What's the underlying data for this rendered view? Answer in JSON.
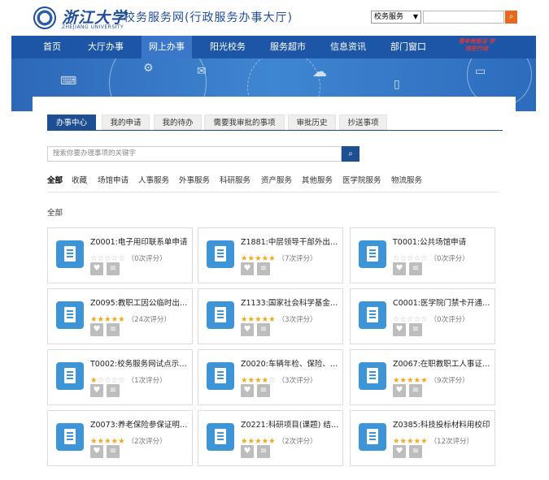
{
  "header": {
    "logo_cn": "浙江大学",
    "logo_en": "ZHEJIANG UNIVERSITY",
    "site_title": "校务服务网(行政服务办事大厅)",
    "scope_select": "校务服务",
    "search_button_icon": "search-icon"
  },
  "nav": {
    "items": [
      "首页",
      "大厅办事",
      "网上办事",
      "阳光校务",
      "服务超市",
      "信息资讯",
      "部门窗口"
    ],
    "active_index": 2,
    "slogan": "青年有担当 学校在行动"
  },
  "tabs": {
    "items": [
      "办事中心",
      "我的申请",
      "我的待办",
      "需要我审批的事项",
      "审批历史",
      "抄送事项"
    ],
    "active_index": 0
  },
  "search": {
    "placeholder": "搜索你要办理事项的关键字"
  },
  "categories": {
    "items": [
      "全部",
      "收藏",
      "场馆申请",
      "人事服务",
      "外事服务",
      "科研服务",
      "资产服务",
      "其他服务",
      "医学院服务",
      "物流服务"
    ],
    "active_index": 0
  },
  "section_title": "全部",
  "services": [
    {
      "title": "Z0001:电子用印联系单申请",
      "stars": 0,
      "rating": "（0次评分）"
    },
    {
      "title": "Z1881:中层领导干部外出报...",
      "stars": 5,
      "rating": "（7次评分）"
    },
    {
      "title": "T0001:公共场馆申请",
      "stars": 0,
      "rating": "（0次评分）"
    },
    {
      "title": "Z0095:教职工因公临时出国...",
      "stars": 5,
      "rating": "（24次评分）"
    },
    {
      "title": "Z1133:国家社会科学基金常...",
      "stars": 5,
      "rating": "（3次评分）"
    },
    {
      "title": "C0001:医学院门禁卡开通申请",
      "stars": 0,
      "rating": "（0次评分）"
    },
    {
      "title": "T0002:校务服务网试点示范...",
      "stars": 1,
      "rating": "（1次评分）"
    },
    {
      "title": "Z0020:车辆年检、保险、保...",
      "stars": 3.5,
      "rating": "（3次评分）"
    },
    {
      "title": "Z0067:在职教职工人事证明...",
      "stars": 5,
      "rating": "（9次评分）"
    },
    {
      "title": "Z0073:养老保险参保证明打...",
      "stars": 5,
      "rating": "（2次评分）"
    },
    {
      "title": "Z0221:科研项目(课题) 结题...",
      "stars": 5,
      "rating": "（2次评分）"
    },
    {
      "title": "Z0385:科技投标材料用校印",
      "stars": 5,
      "rating": "（12次评分）"
    }
  ],
  "colors": {
    "nav_bg": "#1d56a7",
    "tab_active": "#1d4f92",
    "star": "#f0a91b",
    "icon_tile": "#3d95d8",
    "top_search_btn": "#e8691e"
  }
}
